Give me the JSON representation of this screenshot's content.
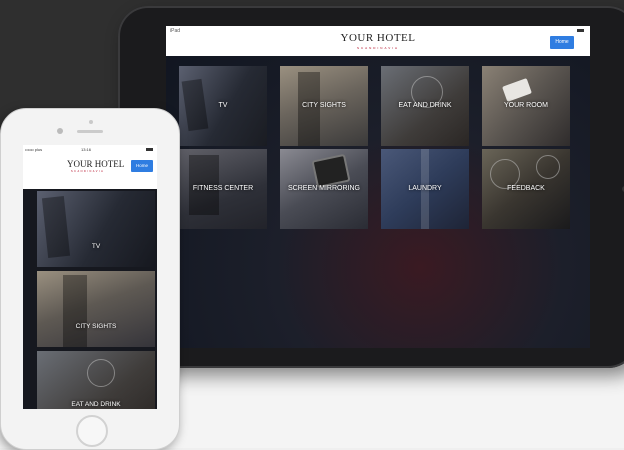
{
  "tablet": {
    "status_left": "iPad",
    "logo": "YOUR HOTEL",
    "logo_sub": "SCANDINAVIA",
    "home_button": "Home",
    "tiles": [
      {
        "label": "TV"
      },
      {
        "label": "CITY SIGHTS"
      },
      {
        "label": "EAT AND DRINK"
      },
      {
        "label": "YOUR ROOM"
      },
      {
        "label": "FITNESS CENTER"
      },
      {
        "label": "SCREEN MIRRORING"
      },
      {
        "label": "LAUNDRY"
      },
      {
        "label": "FEEDBACK"
      }
    ]
  },
  "phone": {
    "status_left": "•••oo plus",
    "status_time": "13:16",
    "logo": "YOUR HOTEL",
    "logo_sub": "SCANDINAVIA",
    "home_button": "Home",
    "tiles": [
      {
        "label": "TV"
      },
      {
        "label": "CITY SIGHTS"
      },
      {
        "label": "EAT AND DRINK"
      }
    ]
  },
  "colors": {
    "accent": "#2f7de1",
    "logo_red": "#b0001c",
    "background_dark": "#2f2f2f",
    "background_light": "#efefef"
  }
}
